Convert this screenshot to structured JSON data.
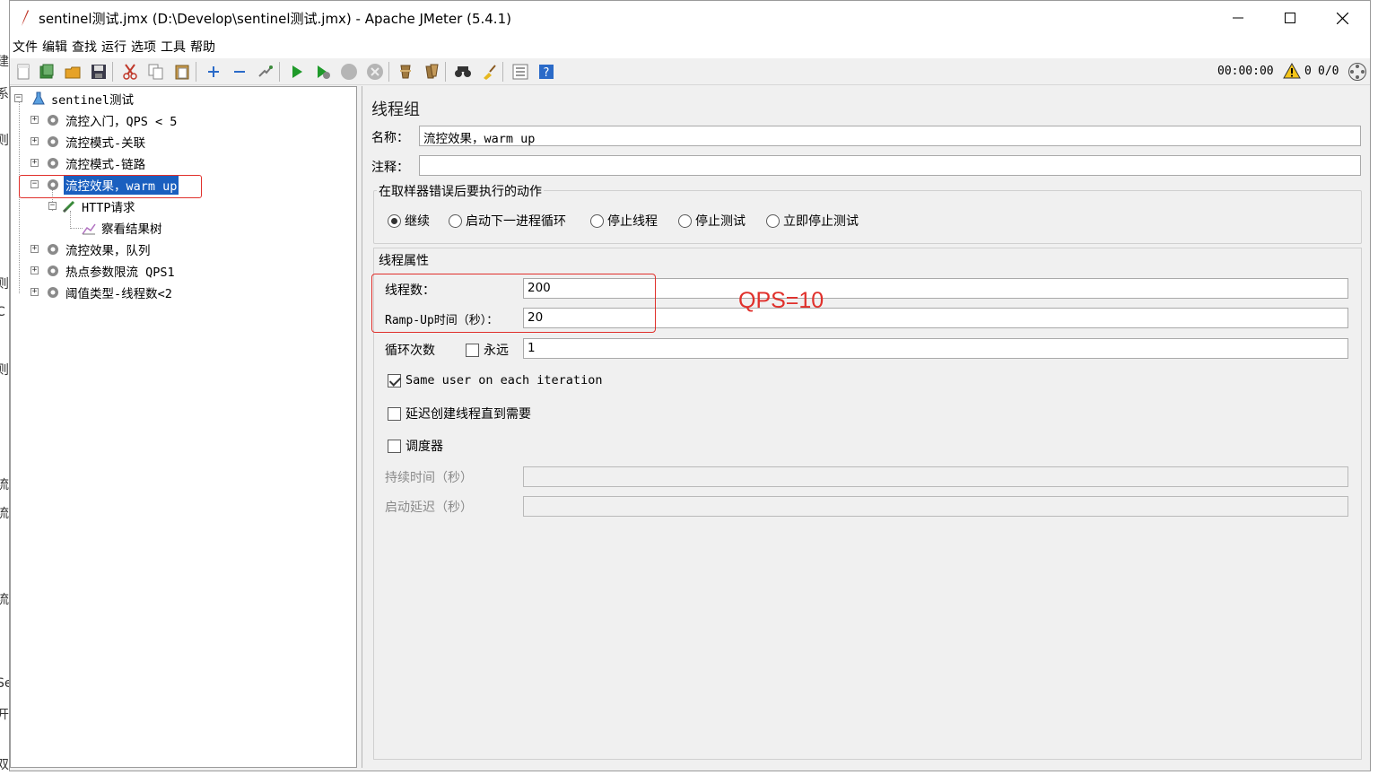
{
  "window": {
    "title": "sentinel测试.jmx (D:\\Develop\\sentinel测试.jmx) - Apache JMeter (5.4.1)"
  },
  "background_fragments": [
    "建",
    "系",
    "则",
    "则",
    "C",
    "则",
    "流",
    "流",
    "流",
    "Se",
    "开",
    "双"
  ],
  "menu": [
    "文件",
    "编辑",
    "查找",
    "运行",
    "选项",
    "工具",
    "帮助"
  ],
  "toolbar": {
    "buttons": [
      "new-icon",
      "templates-icon",
      "open-icon",
      "save-icon",
      "cut-icon",
      "copy-icon",
      "paste-icon",
      "expand-icon",
      "collapse-icon",
      "toggle-icon",
      "start-icon",
      "start-no-pause-icon",
      "stop-icon",
      "shutdown-icon",
      "clear-icon",
      "clear-all-icon",
      "search-icon",
      "reset-search-icon",
      "function-helper-icon",
      "help-icon"
    ],
    "timer": "00:00:00",
    "warnings": "0",
    "threads": "0/0"
  },
  "tree": {
    "root": "sentinel测试",
    "items": [
      {
        "label": "流控入门，QPS < 5"
      },
      {
        "label": "流控模式-关联"
      },
      {
        "label": "流控模式-链路"
      },
      {
        "label": "流控效果，warm up",
        "selected": true
      },
      {
        "label": "HTTP请求"
      },
      {
        "label": "察看结果树"
      },
      {
        "label": "流控效果，队列"
      },
      {
        "label": "热点参数限流 QPS1"
      },
      {
        "label": "阈值类型-线程数<2"
      }
    ]
  },
  "panel": {
    "title": "线程组",
    "name_label": "名称：",
    "name_value": "流控效果，warm up",
    "comment_label": "注释：",
    "comment_value": "",
    "error_group_title": "在取样器错误后要执行的动作",
    "error_actions": [
      "继续",
      "启动下一进程循环",
      "停止线程",
      "停止测试",
      "立即停止测试"
    ],
    "error_action_selected": 0,
    "thread_group_title": "线程属性",
    "threads_label": "线程数：",
    "threads_value": "200",
    "rampup_label": "Ramp-Up时间（秒）：",
    "rampup_value": "20",
    "loop_label": "循环次数",
    "forever_label": "永远",
    "forever_checked": false,
    "loop_value": "1",
    "same_user_label": "Same user on each iteration",
    "same_user_checked": true,
    "delay_create_label": "延迟创建线程直到需要",
    "delay_create_checked": false,
    "scheduler_label": "调度器",
    "scheduler_checked": false,
    "duration_label": "持续时间（秒）",
    "duration_value": "",
    "startup_delay_label": "启动延迟（秒）",
    "startup_delay_value": ""
  },
  "annotation": {
    "text": "QPS=10",
    "color": "#e0302b"
  }
}
